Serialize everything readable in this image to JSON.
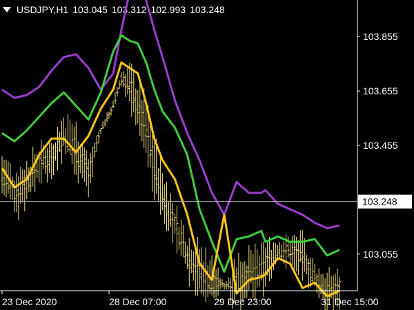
{
  "header": {
    "symbol": "USDJPY,H1",
    "open": "103.045",
    "high": "103.312",
    "low": "102.993",
    "close": "103.248",
    "dropdown_icon": "triangle-down-icon"
  },
  "colors": {
    "background": "#000000",
    "candles": "#f2e27a",
    "upper_band": "#9b3fd1",
    "middle_band": "#3fcf3f",
    "lower_band": "#ffc61a",
    "axis": "#ffffff",
    "current_price_line": "#a8a8a8"
  },
  "chart_data": {
    "type": "line",
    "title": "",
    "xlabel": "",
    "ylabel": "",
    "ylim": [
      102.92,
      103.99
    ],
    "y_ticks": [
      "103.855",
      "103.655",
      "103.455",
      "103.055"
    ],
    "x_ticks": [
      {
        "label": "23 Dec 2020",
        "bar": 0
      },
      {
        "label": "28 Dec 07:00",
        "bar": 52
      },
      {
        "label": "29 Dec 23:00",
        "bar": 103
      },
      {
        "label": "31 Dec 15:00",
        "bar": 155
      }
    ],
    "current_price": {
      "value": 103.248,
      "label": "103.248"
    },
    "x": [
      0,
      6,
      12,
      18,
      24,
      30,
      36,
      42,
      48,
      54,
      58,
      62,
      66,
      70,
      74,
      78,
      84,
      90,
      96,
      102,
      108,
      114,
      120,
      126,
      128,
      134,
      140,
      146,
      152,
      158,
      164
    ],
    "series": [
      {
        "values": [
          103.66,
          103.63,
          103.64,
          103.67,
          103.73,
          103.78,
          103.79,
          103.74,
          103.66,
          103.72,
          103.88,
          104.02,
          104.06,
          103.99,
          103.88,
          103.78,
          103.62,
          103.5,
          103.4,
          103.28,
          103.2,
          103.32,
          103.28,
          103.28,
          103.29,
          103.24,
          103.22,
          103.2,
          103.17,
          103.15,
          103.16
        ]
      },
      {
        "values": [
          103.5,
          103.47,
          103.51,
          103.56,
          103.61,
          103.65,
          103.6,
          103.55,
          103.65,
          103.8,
          103.86,
          103.84,
          103.83,
          103.76,
          103.66,
          103.58,
          103.52,
          103.42,
          103.22,
          103.1,
          102.99,
          103.11,
          103.12,
          103.14,
          103.1,
          103.12,
          103.1,
          103.1,
          103.11,
          103.05,
          103.07
        ]
      },
      {
        "values": [
          103.37,
          103.3,
          103.33,
          103.42,
          103.48,
          103.48,
          103.43,
          103.49,
          103.59,
          103.66,
          103.76,
          103.74,
          103.72,
          103.61,
          103.48,
          103.4,
          103.33,
          103.2,
          103.02,
          102.96,
          103.2,
          102.91,
          102.96,
          102.97,
          102.98,
          103.04,
          103.02,
          102.93,
          102.95,
          102.9,
          102.92
        ]
      },
      {
        "values": [
          103.35,
          103.28,
          103.32,
          103.39,
          103.41,
          103.49,
          103.44,
          103.35,
          103.51,
          103.6,
          103.7,
          103.68,
          103.6,
          103.52,
          103.38,
          103.27,
          103.16,
          103.05,
          102.99,
          102.96,
          102.94,
          102.95,
          102.98,
          102.99,
          103.02,
          103.06,
          103.07,
          103.05,
          102.96,
          102.92,
          102.93
        ]
      }
    ]
  }
}
